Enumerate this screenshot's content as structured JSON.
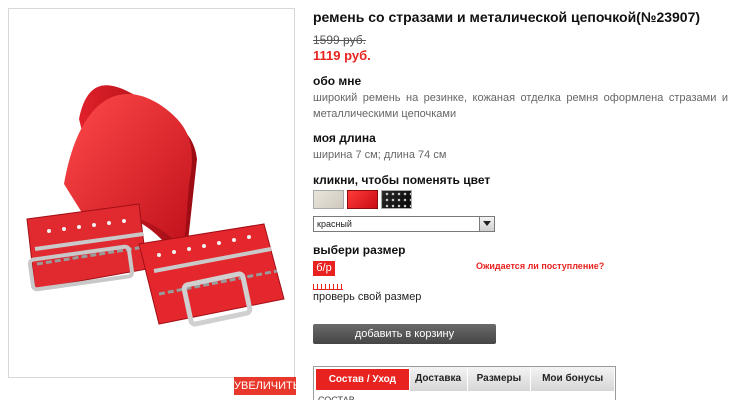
{
  "product": {
    "title": "ремень со стразами и металической цепочкой(№23907)",
    "old_price": "1599 руб.",
    "new_price": "1119 руб.",
    "zoom_label": "УВЕЛИЧИТЬ"
  },
  "about": {
    "heading": "обо мне",
    "text": "широкий ремень на резинке, кожаная отделка ремня оформлена стразами и металлическими цепочками"
  },
  "length": {
    "heading": "моя длина",
    "text": "ширина 7 см; длина 74 см"
  },
  "color": {
    "heading": "кликни, чтобы поменять цвет",
    "swatches": [
      "beige",
      "red",
      "black"
    ],
    "selected": "красный"
  },
  "size": {
    "heading": "выбери размер",
    "selected": "б/р",
    "waiting_link": "Ожидается ли поступление?",
    "check_link": "проверь свой размер"
  },
  "cart": {
    "button_label": "добавить в корзину"
  },
  "tabs": {
    "items": [
      "Состав / Уход",
      "Доставка",
      "Размеры",
      "Мои бонусы"
    ],
    "active": 0,
    "content_heading": "СОСТАВ"
  },
  "colors": {
    "accent": "#e8231f",
    "button_dark": "#4a4a4a"
  }
}
